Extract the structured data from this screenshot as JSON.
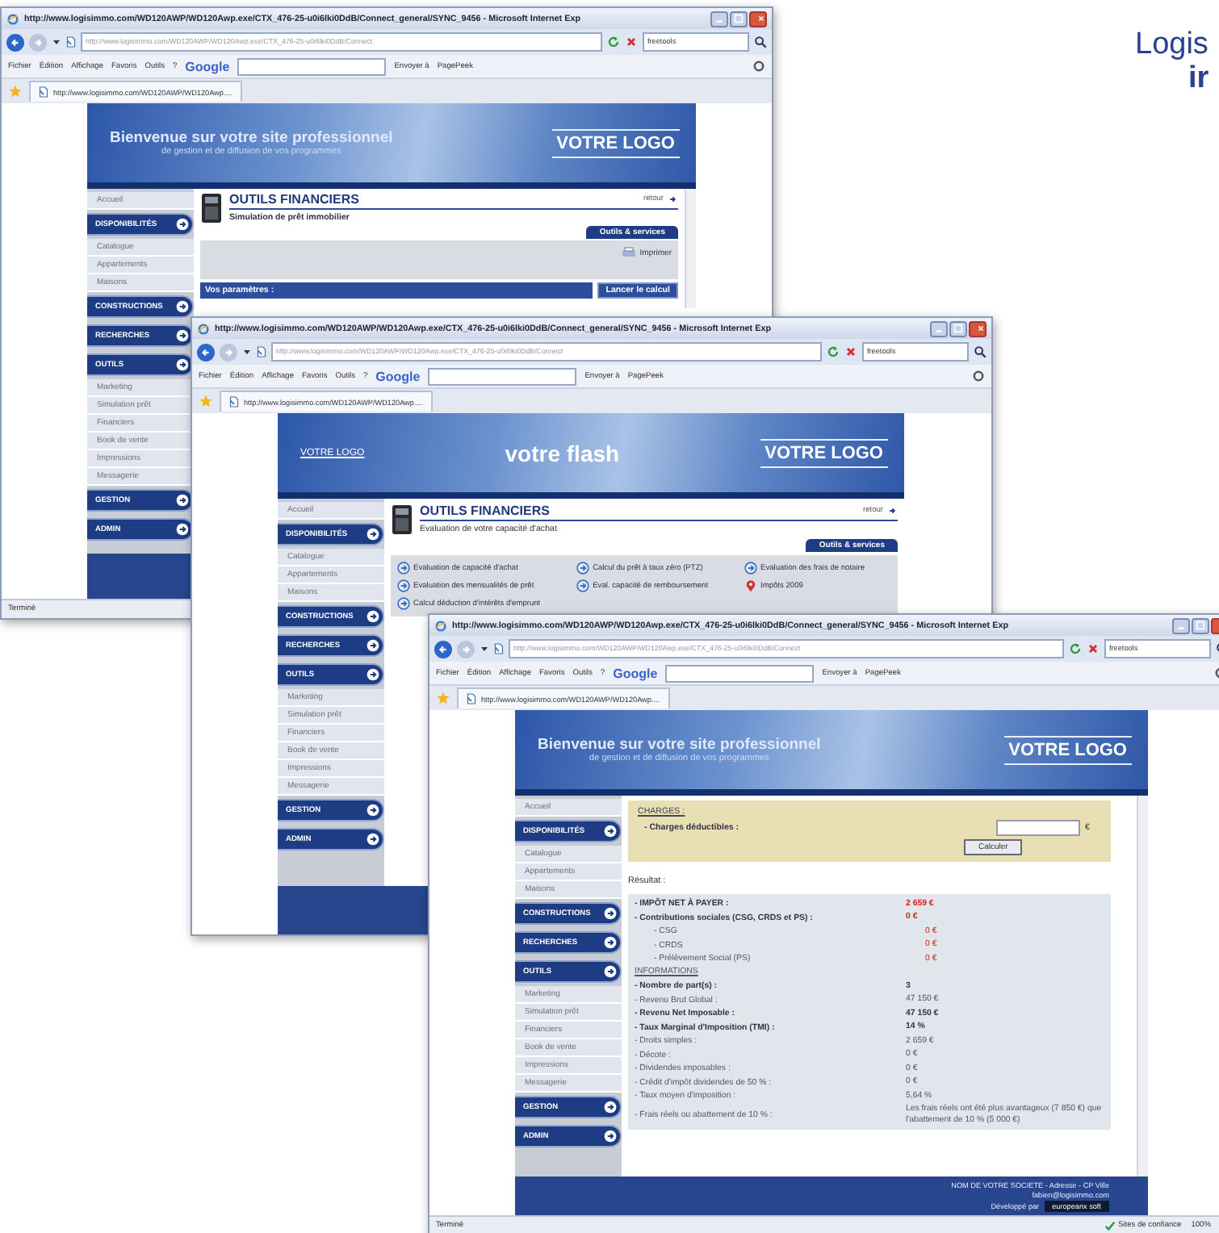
{
  "headline": {
    "line_1": "Logis",
    "line_2": "ir"
  },
  "windows": [
    {
      "title": "http://www.logisimmo.com/WD120AWP/WD120Awp.exe/CTX_476-25-u0i6lki0DdB/Connect_general/SYNC_9456 - Microsoft Internet Exp",
      "address": "http://www.logisimmo.com/WD120AWP/WD120Awp.exe/CTX_476-25-u0i6lki0DdB/Connect",
      "search_value": "freetools",
      "menu": [
        "Fichier",
        "Édition",
        "Affichage",
        "Favoris",
        "Outils",
        "?"
      ],
      "toolbar_logo": "Google",
      "send": "Envoyer à",
      "pagepeek": "PagePeek",
      "tab": "http://www.logisimmo.com/WD120AWP/WD120Awp....",
      "scrollbar": true,
      "banner": {
        "kind": "welcome",
        "title": "Bienvenue sur votre site professionnel",
        "subtitle": "de gestion et de diffusion de vos programmes",
        "logo": "VOTRE LOGO"
      },
      "sidebar": [
        {
          "kind": "link",
          "label": "Accueil"
        },
        {
          "kind": "section",
          "label": "DISPONIBILITÉS"
        },
        {
          "kind": "link",
          "label": "Catalogue"
        },
        {
          "kind": "link",
          "label": "Appartements"
        },
        {
          "kind": "link",
          "label": "Maisons"
        },
        {
          "kind": "section",
          "label": "CONSTRUCTIONS"
        },
        {
          "kind": "section",
          "label": "RECHERCHES"
        },
        {
          "kind": "section",
          "label": "OUTILS"
        },
        {
          "kind": "link",
          "label": "Marketing"
        },
        {
          "kind": "link",
          "label": "Simulation prêt"
        },
        {
          "kind": "link",
          "label": "Financiers"
        },
        {
          "kind": "link",
          "label": "Book de vente"
        },
        {
          "kind": "link",
          "label": "Impressions"
        },
        {
          "kind": "link",
          "label": "Messagerie"
        },
        {
          "kind": "section",
          "label": "GESTION"
        },
        {
          "kind": "section",
          "label": "ADMIN"
        }
      ],
      "content": {
        "kind": "simulation",
        "title": "OUTILS FINANCIERS",
        "subtitle": "Simulation de prêt immobilier",
        "back": "retour",
        "tab": "Outils & services",
        "print": "Imprimer",
        "params": "Vos paramètres :",
        "run": "Lancer le calcul"
      },
      "status": {
        "text": "Terminé"
      }
    },
    {
      "title": "http://www.logisimmo.com/WD120AWP/WD120Awp.exe/CTX_476-25-u0i6lki0DdB/Connect_general/SYNC_9456 - Microsoft Internet Exp",
      "address": "http://www.logisimmo.com/WD120AWP/WD120Awp.exe/CTX_476-25-u0i6lki0DdB/Connect",
      "search_value": "freetools",
      "menu": [
        "Fichier",
        "Édition",
        "Affichage",
        "Favoris",
        "Outils",
        "?"
      ],
      "toolbar_logo": "Google",
      "send": "Envoyer à",
      "pagepeek": "PagePeek",
      "tab": "http://www.logisimmo.com/WD120AWP/WD120Awp....",
      "scrollbar": false,
      "banner": {
        "kind": "flash",
        "small_logo": "VOTRE LOGO",
        "flash": "votre flash",
        "logo": "VOTRE LOGO"
      },
      "sidebar": [
        {
          "kind": "link",
          "label": "Accueil"
        },
        {
          "kind": "section",
          "label": "DISPONIBILITÉS"
        },
        {
          "kind": "link",
          "label": "Catalogue"
        },
        {
          "kind": "link",
          "label": "Appartements"
        },
        {
          "kind": "link",
          "label": "Maisons"
        },
        {
          "kind": "section",
          "label": "CONSTRUCTIONS"
        },
        {
          "kind": "section",
          "label": "RECHERCHES"
        },
        {
          "kind": "section",
          "label": "OUTILS"
        },
        {
          "kind": "link",
          "label": "Marketing"
        },
        {
          "kind": "link",
          "label": "Simulation prêt"
        },
        {
          "kind": "link",
          "label": "Financiers"
        },
        {
          "kind": "link",
          "label": "Book de vente"
        },
        {
          "kind": "link",
          "label": "Impressions"
        },
        {
          "kind": "link",
          "label": "Messagerie"
        },
        {
          "kind": "section",
          "label": "GESTION"
        },
        {
          "kind": "section",
          "label": "ADMIN"
        }
      ],
      "content": {
        "kind": "evaluation",
        "title": "OUTILS FINANCIERS",
        "subtitle": "Evaluation de votre capacité d'achat",
        "back": "retour",
        "tab": "Outils & services",
        "links": [
          {
            "kind": "arrow",
            "label": "Evaluation de capacité d'achat"
          },
          {
            "kind": "arrow",
            "label": "Calcul du prêt à taux zéro (PTZ)"
          },
          {
            "kind": "arrow",
            "label": "Evaluation des frais de notaire"
          },
          {
            "kind": "arrow",
            "label": "Evaluation des mensualités de prêt"
          },
          {
            "kind": "arrow",
            "label": "Eval. capacité de remboursement"
          },
          {
            "kind": "pin",
            "label": "Impôts 2009"
          },
          {
            "kind": "arrow",
            "label": "Calcul déduction d'intérêts d'emprunt"
          }
        ]
      }
    },
    {
      "title": "http://www.logisimmo.com/WD120AWP/WD120Awp.exe/CTX_476-25-u0i6lki0DdB/Connect_general/SYNC_9456 - Microsoft Internet Exp",
      "address": "http://www.logisimmo.com/WD120AWP/WD120Awp.exe/CTX_476-25-u0i6lki0DdB/Connect",
      "search_value": "freetools",
      "menu": [
        "Fichier",
        "Édition",
        "Affichage",
        "Favoris",
        "Outils",
        "?"
      ],
      "toolbar_logo": "Google",
      "send": "Envoyer à",
      "pagepeek": "PagePeek",
      "tab": "http://www.logisimmo.com/WD120AWP/WD120Awp....",
      "scrollbar": true,
      "banner": {
        "kind": "welcome",
        "title": "Bienvenue sur votre site professionnel",
        "subtitle": "de gestion et de diffusion de vos programmes",
        "logo": "VOTRE LOGO"
      },
      "sidebar": [
        {
          "kind": "link",
          "label": "Accueil"
        },
        {
          "kind": "section",
          "label": "DISPONIBILITÉS"
        },
        {
          "kind": "link",
          "label": "Catalogue"
        },
        {
          "kind": "link",
          "label": "Appartements"
        },
        {
          "kind": "link",
          "label": "Maisons"
        },
        {
          "kind": "section",
          "label": "CONSTRUCTIONS"
        },
        {
          "kind": "section",
          "label": "RECHERCHES"
        },
        {
          "kind": "section",
          "label": "OUTILS"
        },
        {
          "kind": "link",
          "label": "Marketing"
        },
        {
          "kind": "link",
          "label": "Simulation prêt"
        },
        {
          "kind": "link",
          "label": "Financiers"
        },
        {
          "kind": "link",
          "label": "Book de vente"
        },
        {
          "kind": "link",
          "label": "Impressions"
        },
        {
          "kind": "link",
          "label": "Messagerie"
        },
        {
          "kind": "section",
          "label": "GESTION"
        },
        {
          "kind": "section",
          "label": "ADMIN"
        }
      ],
      "content": {
        "kind": "impots",
        "charges_title": "CHARGES :",
        "charges_label": "- Charges déductibles :",
        "currency": "€",
        "calculate": "Calculer",
        "result_title": "Résultat :",
        "results": [
          {
            "kind": "row",
            "label": "- IMPÔT NET À PAYER :",
            "value": "2 659 €",
            "bold": true,
            "alert": true
          },
          {
            "kind": "row",
            "label": "- Contributions sociales (CSG, CRDS et PS) :",
            "value": "0 €",
            "bold": true,
            "alert": true,
            "children": [
              {
                "kind": "row",
                "label": "- CSG",
                "value": "0 €",
                "bold": false,
                "alert": true
              },
              {
                "kind": "row",
                "label": "- CRDS",
                "value": "0 €",
                "bold": false,
                "alert": true
              },
              {
                "kind": "row",
                "label": "- Prélèvement Social (PS)",
                "value": "0 €",
                "bold": false,
                "alert": true
              }
            ]
          },
          {
            "kind": "heading",
            "label": "INFORMATIONS"
          },
          {
            "kind": "row",
            "label": "- Nombre de part(s) :",
            "value": "3",
            "bold": true,
            "alert": false
          },
          {
            "kind": "row",
            "label": "- Revenu Brut Global :",
            "value": "47 150 €",
            "bold": false,
            "alert": false
          },
          {
            "kind": "row",
            "label": "- Revenu Net Imposable :",
            "value": "47 150 €",
            "bold": true,
            "alert": false
          },
          {
            "kind": "row",
            "label": "- Taux Marginal d'Imposition (TMI) :",
            "value": "14 %",
            "bold": true,
            "alert": false
          },
          {
            "kind": "row",
            "label": "- Droits simples :",
            "value": "2 659 €",
            "bold": false,
            "alert": false
          },
          {
            "kind": "row",
            "label": "- Décote :",
            "value": "0 €",
            "bold": false,
            "alert": false
          },
          {
            "kind": "row",
            "label": "- Dividendes imposables :",
            "value": "0 €",
            "bold": false,
            "alert": false
          },
          {
            "kind": "row",
            "label": "- Crédit d'impôt dividendes de 50 % :",
            "value": "0 €",
            "bold": false,
            "alert": false
          },
          {
            "kind": "row",
            "label": "- Taux moyen d'imposition :",
            "value": "5,64 %",
            "bold": false,
            "alert": false
          },
          {
            "kind": "row",
            "label": "- Frais réels ou abattement de 10 % :",
            "value": "Les frais réels ont été plus avantageux (7 850 €) que l'abattement de 10 % (5 000 €)",
            "bold": false,
            "alert": false
          }
        ]
      },
      "footer": {
        "company": "NOM DE VOTRE SOCIETE - Adresse - CP Ville",
        "email": "fabien@logisimmo.com",
        "credit": "Développé par",
        "badge": "europeanx soft"
      },
      "status": {
        "text": "Terminé",
        "zone": "Sites de confiance",
        "zoom": "100%"
      }
    }
  ]
}
